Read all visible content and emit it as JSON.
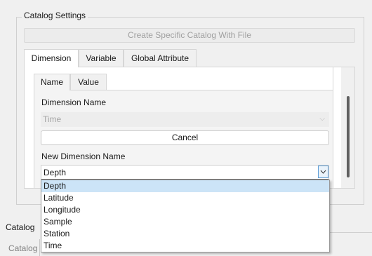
{
  "group": {
    "title": "Catalog Settings"
  },
  "create_button": "Create Specific Catalog With File",
  "outer_tabs": [
    "Dimension",
    "Variable",
    "Global Attribute"
  ],
  "inner_tabs": [
    "Name",
    "Value"
  ],
  "dimension_name": {
    "label": "Dimension Name",
    "value": "Time"
  },
  "cancel_button": "Cancel",
  "new_dimension_name": {
    "label": "New Dimension Name",
    "value": "Depth",
    "options": [
      "Depth",
      "Latitude",
      "Longitude",
      "Sample",
      "Station",
      "Time"
    ]
  },
  "background": {
    "catalog_label_clipped": "Catalog",
    "catalog_label": "Catalog"
  }
}
